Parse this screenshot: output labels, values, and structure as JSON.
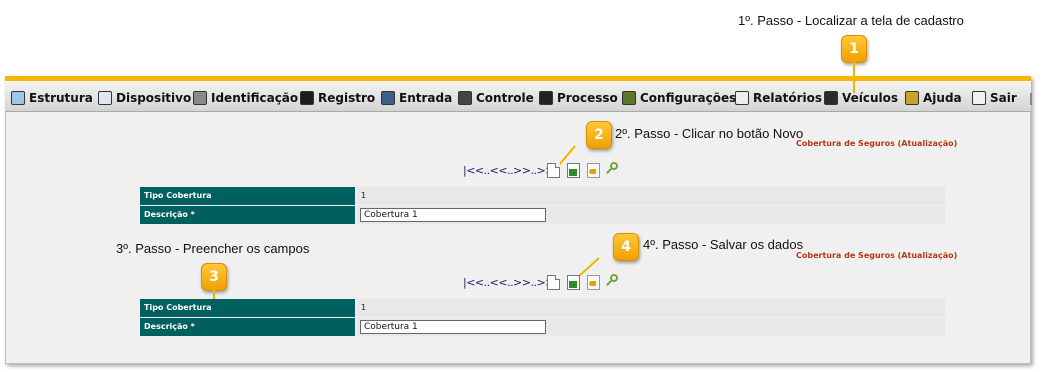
{
  "annotations": {
    "step1": "1º. Passo - Localizar a tela de cadastro",
    "step2": "2º. Passo - Clicar no botão Novo",
    "step3": "3º. Passo - Preencher os campos",
    "step4": "4º. Passo - Salvar os dados",
    "badge1": "1",
    "badge2": "2",
    "badge3": "3",
    "badge4": "4"
  },
  "menu": {
    "items": [
      {
        "label": "Estrutura",
        "icon": "structure-icon"
      },
      {
        "label": "Dispositivo",
        "icon": "device-icon"
      },
      {
        "label": "Identificação",
        "icon": "identification-icon"
      },
      {
        "label": "Registro",
        "icon": "register-icon"
      },
      {
        "label": "Entrada",
        "icon": "entry-icon"
      },
      {
        "label": "Controle",
        "icon": "control-icon"
      },
      {
        "label": "Processo",
        "icon": "process-icon"
      },
      {
        "label": "Configurações",
        "icon": "settings-icon"
      },
      {
        "label": "Relatórios",
        "icon": "reports-icon"
      },
      {
        "label": "Veículos",
        "icon": "vehicle-icon"
      },
      {
        "label": "Ajuda",
        "icon": "help-icon"
      },
      {
        "label": "Sair",
        "icon": "exit-icon"
      }
    ]
  },
  "forms": [
    {
      "title": "Cobertura de Seguros (Atualização)",
      "nav": "|<<..<<..>>..>>|",
      "fields": [
        {
          "label": "Tipo Cobertura",
          "value": "1"
        },
        {
          "label": "Descrição *",
          "value": "Cobertura 1"
        }
      ]
    },
    {
      "title": "Cobertura de Seguros (Atualização)",
      "nav": "|<<..<<..>>..>>|",
      "fields": [
        {
          "label": "Tipo Cobertura",
          "value": "1"
        },
        {
          "label": "Descrição *",
          "value": "Cobertura 1"
        }
      ]
    }
  ],
  "colors": {
    "accent": "#f5b800",
    "label_bg": "#005f5f",
    "title_red": "#b53a14",
    "badge": "#f5a800"
  }
}
